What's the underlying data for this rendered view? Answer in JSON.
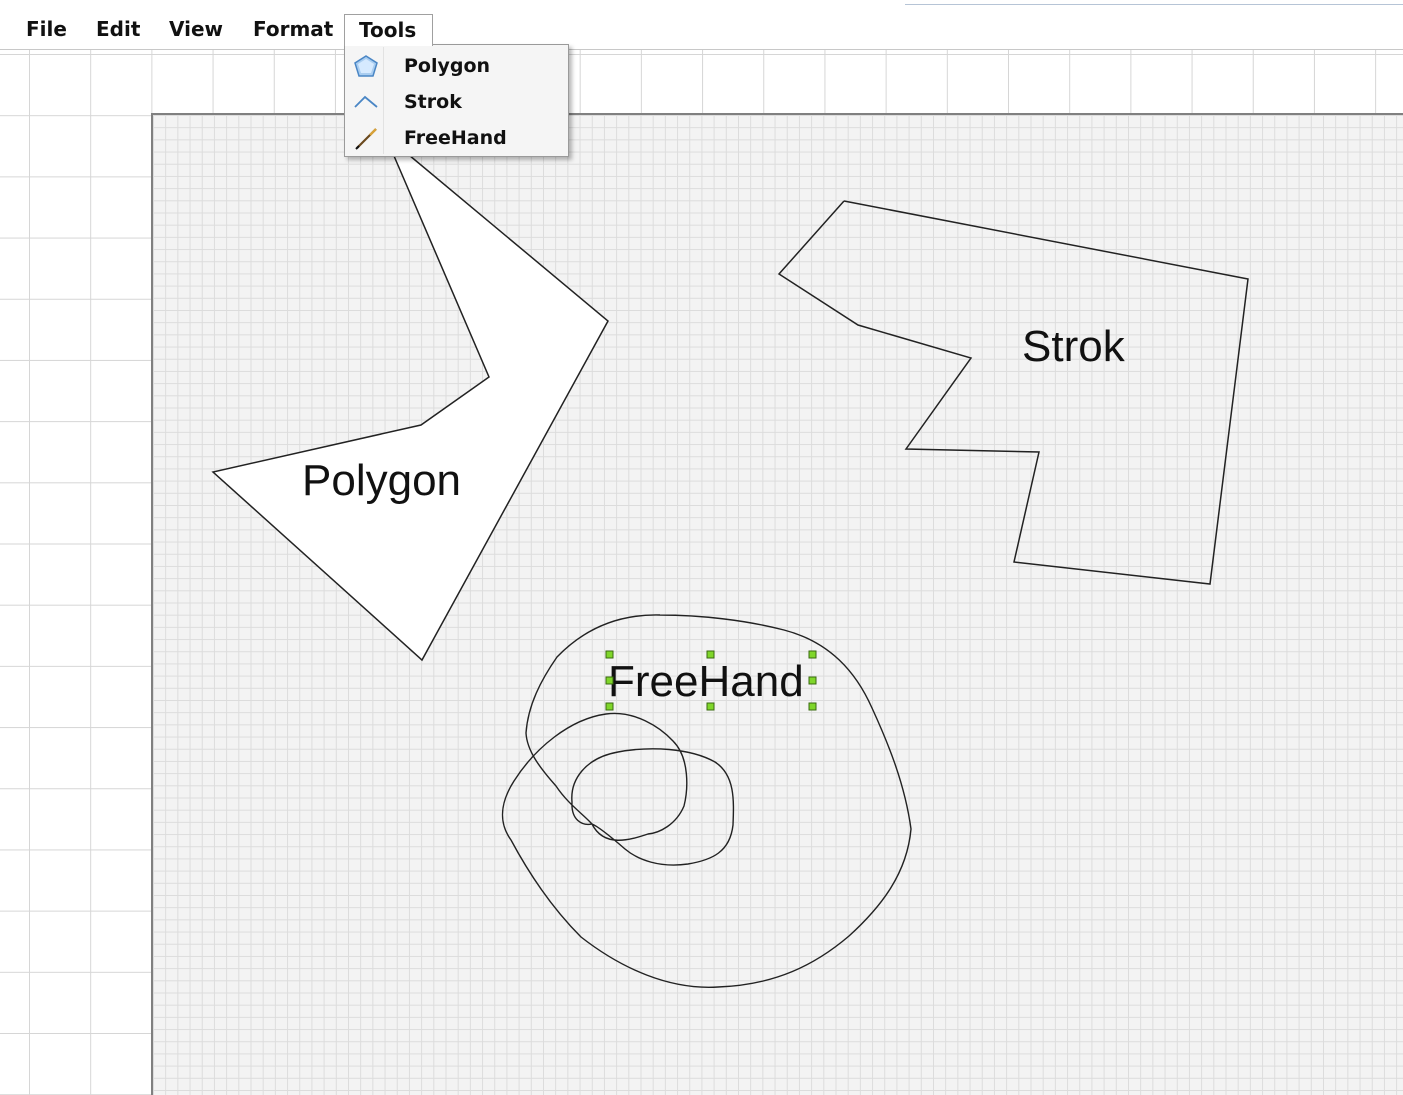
{
  "menubar": {
    "items": [
      {
        "label": "File"
      },
      {
        "label": "Edit"
      },
      {
        "label": "View"
      },
      {
        "label": "Format"
      },
      {
        "label": "Tools"
      }
    ],
    "open_menu": "Tools"
  },
  "tools_menu": {
    "items": [
      {
        "label": "Polygon",
        "icon": "polygon-icon"
      },
      {
        "label": "Strok",
        "icon": "stroke-icon"
      },
      {
        "label": "FreeHand",
        "icon": "freehand-pencil-icon"
      }
    ]
  },
  "canvas": {
    "shapes": [
      {
        "type": "polygon",
        "label": "Polygon",
        "fill": "#ffffff",
        "selected": false
      },
      {
        "type": "stroke",
        "label": "Strok",
        "fill": "none",
        "selected": false
      },
      {
        "type": "freehand",
        "label": "FreeHand",
        "fill": "none",
        "selected": true
      }
    ]
  },
  "colors": {
    "selection_handle": "#7fd62a",
    "stroke": "#222222",
    "canvas_background": "#f3f3f3"
  }
}
